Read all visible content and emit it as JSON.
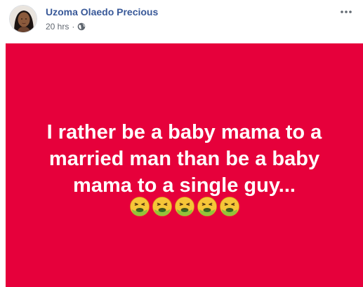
{
  "author": {
    "name": "Uzoma Olaedo Precious",
    "time": "20 hrs",
    "separator": "·",
    "privacy_icon": "globe-icon"
  },
  "menu": {
    "icon": "more-horizontal-icon"
  },
  "post": {
    "background_color": "#e6003b",
    "text_color": "#ffffff",
    "lines": [
      "I rather be a baby mama to a",
      "married man than be a baby",
      "mama to a single guy..."
    ],
    "emoji": [
      "🤮",
      "🤮",
      "🤮",
      "🤮",
      "🤮"
    ]
  },
  "colors": {
    "name": "#385898",
    "meta": "#616770"
  }
}
